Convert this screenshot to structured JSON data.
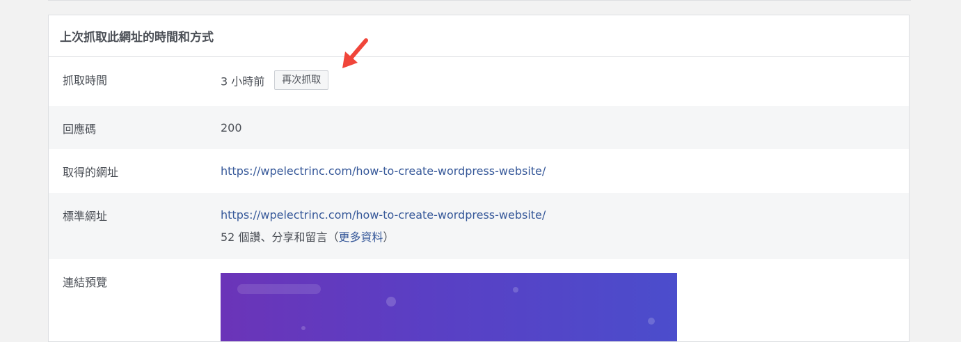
{
  "section_title": "上次抓取此網址的時間和方式",
  "rows": {
    "fetch_time": {
      "label": "抓取時間",
      "value": "3 小時前",
      "button": "再次抓取"
    },
    "response_code": {
      "label": "回應碼",
      "value": "200"
    },
    "fetched_url": {
      "label": "取得的網址",
      "value": "https://wpelectrinc.com/how-to-create-wordpress-website/"
    },
    "canonical_url": {
      "label": "標準網址",
      "value": "https://wpelectrinc.com/how-to-create-wordpress-website/",
      "engagement_prefix": "52 個讚、分享和留言（",
      "more_info": "更多資料",
      "engagement_suffix": "）"
    },
    "link_preview": {
      "label": "連結預覽"
    }
  },
  "colors": {
    "link": "#365899",
    "arrow": "#f0453a",
    "preview_start": "#6b34b8",
    "preview_end": "#4b4dcc"
  },
  "icons": {
    "annotation": "red-arrow-icon"
  }
}
